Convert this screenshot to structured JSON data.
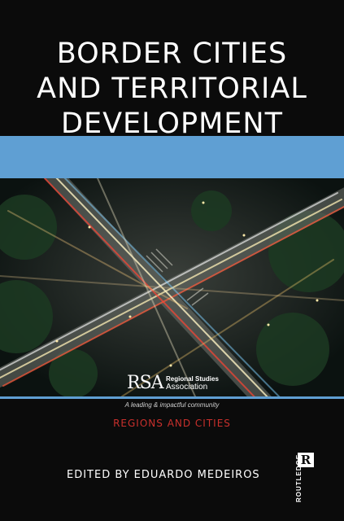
{
  "cover": {
    "title_lines": [
      "BORDER CITIES",
      "AND TERRITORIAL",
      "DEVELOPMENT"
    ],
    "association": {
      "mark": "RSA",
      "name_line1": "Regional Studies",
      "name_line2": "Association"
    },
    "tagline": "A leading & impactful community",
    "series": "REGIONS AND CITIES",
    "editor": "EDITED BY EDUARDO MEDEIROS",
    "publisher": {
      "mark": "R",
      "name": "ROUTLEDGE"
    }
  },
  "colors": {
    "background": "#0b0b0b",
    "band_blue": "#5f9fd3",
    "series_red": "#c9302c",
    "title_white": "#ffffff"
  },
  "image": {
    "subject": "aerial-night-city-intersection"
  }
}
